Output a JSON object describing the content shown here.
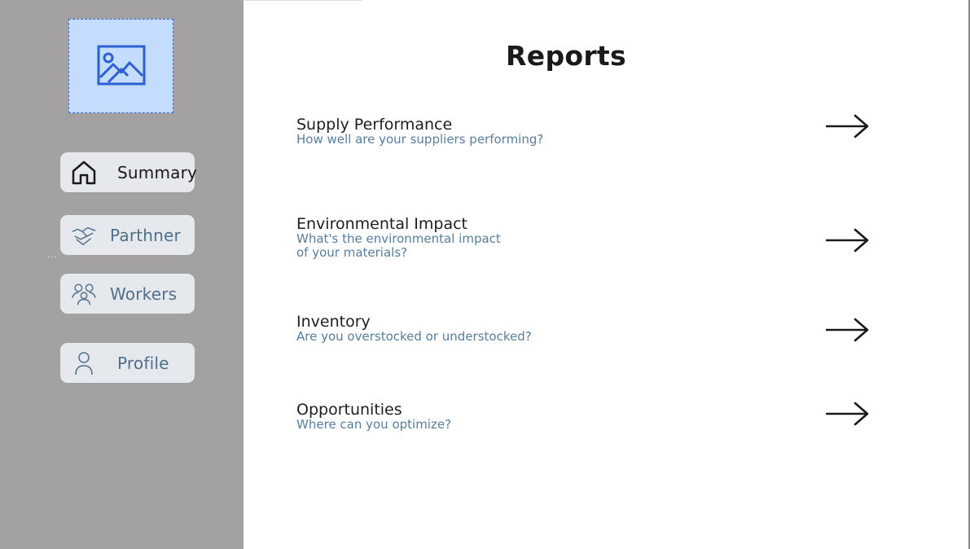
{
  "sidebar": {
    "logo": {
      "icon": "image-placeholder-icon"
    },
    "dots": "...",
    "items": [
      {
        "label": "Summary",
        "icon": "home-icon",
        "active": true
      },
      {
        "label": "Parthner",
        "icon": "handshake-icon",
        "active": false
      },
      {
        "label": "Workers",
        "icon": "people-icon",
        "active": false
      },
      {
        "label": "Profile",
        "icon": "user-icon",
        "active": false
      }
    ]
  },
  "main": {
    "title": "Reports",
    "reports": [
      {
        "title": "Supply Performance",
        "subtitle": "How well are your suppliers performing?",
        "action_icon": "arrow-right-icon"
      },
      {
        "title": "Environmental Impact",
        "subtitle": "What's the environmental impact of your materials?",
        "action_icon": "arrow-right-icon"
      },
      {
        "title": "Inventory",
        "subtitle": "Are you overstocked or understocked?",
        "action_icon": "arrow-right-icon"
      },
      {
        "title": "Opportunities",
        "subtitle": "Where can you optimize?",
        "action_icon": "arrow-right-icon"
      }
    ]
  },
  "colors": {
    "sidebar_bg": "#a4a1a2",
    "nav_item_bg": "#e5e8ec",
    "logo_bg": "#c4dcfd",
    "logo_accent": "#3566d6",
    "subtitle_text": "#567e9d",
    "nav_text": "#4f6f8a"
  }
}
